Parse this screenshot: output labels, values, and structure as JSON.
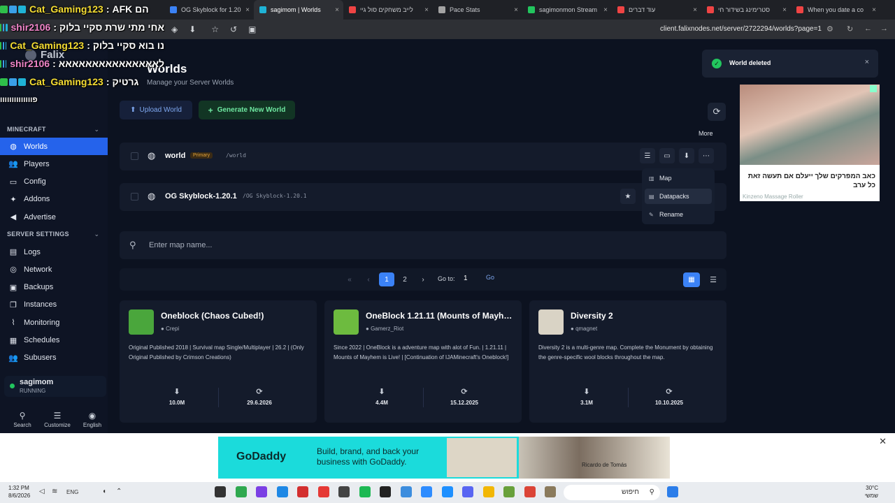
{
  "chat": [
    {
      "name": "Cat_Gaming123",
      "sep": ":",
      "msg": "הם AFK",
      "color": "yellow"
    },
    {
      "name": "shir2106",
      "sep": ":",
      "msg": "אחי מתי שרת סקיי בלוק",
      "color": "pink"
    },
    {
      "name": "Cat_Gaming123",
      "sep": ":",
      "msg": "נו בוא סקיי בלוק",
      "color": "yellow"
    },
    {
      "name": "shir2106",
      "sep": ":",
      "msg": "לאאאאאאאאאאאאאאא",
      "color": "pink"
    },
    {
      "name": "Cat_Gaming123",
      "sep": ":",
      "msg": "גרטיק",
      "color": "yellow"
    },
    {
      "name": "",
      "sep": "",
      "msg": "פוווווווווווווו",
      "color": "none"
    }
  ],
  "browser": {
    "tabs": [
      {
        "label": "OG Skyblock for 1.20",
        "color": "#3b82f6"
      },
      {
        "label": "sagimom | Worlds",
        "color": "#1fb3d6",
        "active": true
      },
      {
        "label": "לייב משחקים סול גיי",
        "color": "#ef4444"
      },
      {
        "label": "Pace Stats",
        "color": "#a3a3a3"
      },
      {
        "label": "sagimonmon Stream",
        "color": "#22c55e"
      },
      {
        "label": "עוד דברים",
        "color": "#ef4444"
      },
      {
        "label": "סטרימינג בשידור חי",
        "color": "#ef4444"
      },
      {
        "label": "When you date a co",
        "color": "#ef4444"
      }
    ],
    "url": "client.falixnodes.net/server/2722294/worlds?page=1"
  },
  "brand": {
    "name": "Falix"
  },
  "sidebar": {
    "section_minecraft": "MINECRAFT",
    "section_settings": "SERVER SETTINGS",
    "minecraft_items": [
      {
        "label": "Worlds",
        "icon": "globe-icon",
        "glyph": "◍"
      },
      {
        "label": "Players",
        "icon": "users-icon",
        "glyph": "👥"
      },
      {
        "label": "Config",
        "icon": "folder-icon",
        "glyph": "▭"
      },
      {
        "label": "Addons",
        "icon": "puzzle-icon",
        "glyph": "✦"
      },
      {
        "label": "Advertise",
        "icon": "megaphone-icon",
        "glyph": "◀"
      }
    ],
    "settings_items": [
      {
        "label": "Logs",
        "icon": "file-icon",
        "glyph": "▤"
      },
      {
        "label": "Network",
        "icon": "network-icon",
        "glyph": "◎"
      },
      {
        "label": "Backups",
        "icon": "archive-icon",
        "glyph": "▣"
      },
      {
        "label": "Instances",
        "icon": "layers-icon",
        "glyph": "❐"
      },
      {
        "label": "Monitoring",
        "icon": "chart-icon",
        "glyph": "⌇"
      },
      {
        "label": "Schedules",
        "icon": "calendar-icon",
        "glyph": "▦"
      },
      {
        "label": "Subusers",
        "icon": "user-group-icon",
        "glyph": "👥"
      }
    ],
    "server": {
      "name": "sagimom",
      "status": "RUNNING",
      "status_color": "#22c55e"
    },
    "footer": [
      {
        "label": "Search",
        "icon": "search-icon",
        "glyph": "⚲"
      },
      {
        "label": "Customize",
        "icon": "sliders-icon",
        "glyph": "☰"
      },
      {
        "label": "English",
        "icon": "language-icon",
        "glyph": "◉"
      }
    ]
  },
  "main": {
    "title": "Worlds",
    "subtitle": "Manage your Server Worlds",
    "upload_label": "Upload World",
    "generate_label": "Generate New World",
    "more_tooltip": "More",
    "worlds": [
      {
        "name": "world",
        "badge": "Primary",
        "path": "/world"
      },
      {
        "name": "OG Skyblock-1.20.1",
        "badge": "",
        "path": "/OG Skyblock-1.20.1"
      }
    ],
    "menu": [
      {
        "label": "Map",
        "icon": "map-icon"
      },
      {
        "label": "Datapacks",
        "icon": "package-icon"
      },
      {
        "label": "Rename",
        "icon": "pencil-icon"
      }
    ],
    "search_placeholder": "Enter map name...",
    "pagination": {
      "current": "1",
      "pages": [
        "1",
        "2"
      ],
      "goto_label": "Go to:",
      "goto_value": "1",
      "go_label": "Go"
    },
    "cards": [
      {
        "title": "Oneblock (Chaos Cubed!)",
        "author": "Crepi",
        "desc": "Original Published 2018 | Survival map Single/Multiplayer | 26.2 | (Only Original Published by Crimson Creations)",
        "downloads": "10.0M",
        "updated": "29.6.2026",
        "thumb": "#4aa63c"
      },
      {
        "title": "OneBlock 1.21.11 (Mounts of Mayhem)",
        "author": "Gamerz_Riot",
        "desc": "Since 2022 | OneBlock is a adventure map with alot of Fun. | 1.21.11 | Mounts of Mayhem is Live! | [Continuation of IJAMinecraft's Oneblock!]",
        "downloads": "4.4M",
        "updated": "15.12.2025",
        "thumb": "#6dbb3f"
      },
      {
        "title": "Diversity 2",
        "author": "qmagnet",
        "desc": "Diversity 2 is a multi-genre map. Complete the Monument by obtaining the genre-specific wool blocks throughout the map.",
        "downloads": "3.1M",
        "updated": "10.10.2025",
        "thumb": "#d9d3c5"
      }
    ]
  },
  "toast": {
    "message": "World deleted",
    "color": "#22c55e"
  },
  "ads": {
    "side_text": "כאב המפרקים שלך ייעלם אם תעשה זאת כל ערב",
    "side_source": "Kinzeno Massage Roller",
    "godaddy_logo": "GoDaddy",
    "godaddy_slogan": "Build, brand, and back your business with GoDaddy.",
    "godaddy_person": "Ricardo de Tomás"
  },
  "taskbar": {
    "time": "1:32 PM",
    "date": "8/6/2026",
    "lang": "ENG",
    "search": "חיפוש",
    "temp": "30°C",
    "weather": "שמשי"
  }
}
